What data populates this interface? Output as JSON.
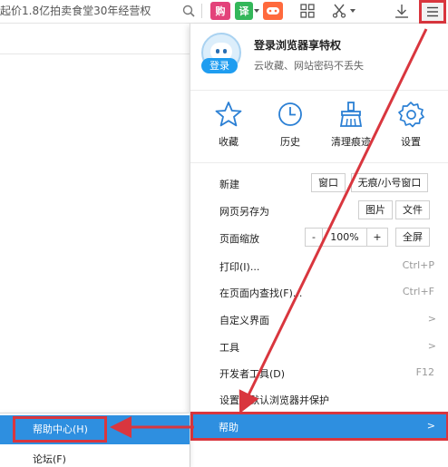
{
  "topbar": {
    "address_text": "起价1.8亿拍卖食堂30年经营权",
    "icons": [
      "search-icon",
      "gou-icon",
      "yi-icon",
      "game-icon",
      "apps-icon",
      "scissors-icon",
      "download-icon",
      "hamburger-menu-icon"
    ],
    "gou_label": "购",
    "yi_label": "译"
  },
  "menu": {
    "login": {
      "title": "登录浏览器享特权",
      "subtitle": "云收藏、网站密码不丢失",
      "button": "登录"
    },
    "quick": [
      {
        "label": "收藏",
        "icon": "star-icon"
      },
      {
        "label": "历史",
        "icon": "clock-icon"
      },
      {
        "label": "清理痕迹",
        "icon": "broom-icon"
      },
      {
        "label": "设置",
        "icon": "gear-icon"
      }
    ],
    "items": {
      "new": {
        "label": "新建",
        "btn1": "窗口",
        "btn2": "无痕/小号窗口"
      },
      "save": {
        "label": "网页另存为",
        "btn1": "图片",
        "btn2": "文件"
      },
      "zoom": {
        "label": "页面缩放",
        "minus": "-",
        "value": "100%",
        "plus": "+",
        "fullscreen": "全屏"
      },
      "print": {
        "label": "打印(I)...",
        "shortcut": "Ctrl+P"
      },
      "find": {
        "label": "在页面内查找(F)...",
        "shortcut": "Ctrl+F"
      },
      "custom": {
        "label": "自定义界面",
        "arrow": ">"
      },
      "tools": {
        "label": "工具",
        "arrow": ">"
      },
      "dev": {
        "label": "开发者工具(D)",
        "shortcut": "F12"
      },
      "default": {
        "label": "设置为默认浏览器并保护"
      },
      "help": {
        "label": "帮助",
        "arrow": ">"
      }
    }
  },
  "submenu": {
    "help_center": "帮助中心(H)",
    "forum": "论坛(F)"
  },
  "colors": {
    "highlight_blue": "#2e8fe0",
    "annotation_red": "#d9363e",
    "login_blue": "#1f9df0"
  }
}
